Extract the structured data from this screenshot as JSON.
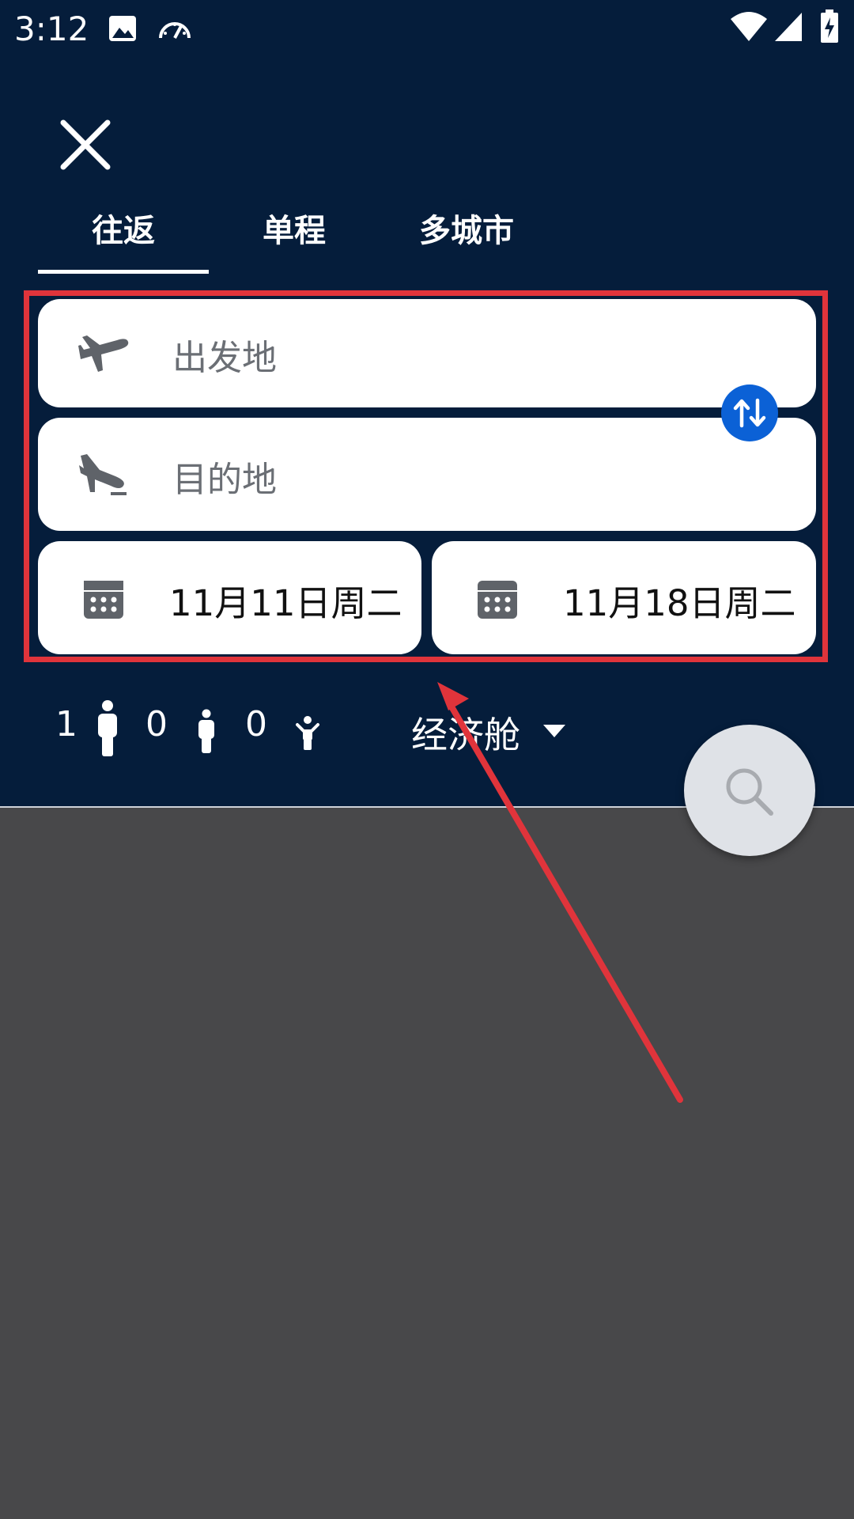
{
  "status_bar": {
    "time": "3:12"
  },
  "tabs": [
    {
      "label": "往返",
      "active": true
    },
    {
      "label": "单程",
      "active": false
    },
    {
      "label": "多城市",
      "active": false
    }
  ],
  "form": {
    "origin_placeholder": "出发地",
    "destination_placeholder": "目的地",
    "depart_date": "11月11日周二",
    "return_date": "11月18日周二"
  },
  "passengers": {
    "adults": "1",
    "children": "0",
    "infants": "0"
  },
  "cabin_class": "经济舱",
  "colors": {
    "header_bg": "#051d3b",
    "accent_blue": "#0b61d6",
    "annotation_red": "#e0343b",
    "overlay_gray": "#48484a"
  },
  "icons": {
    "close": "close-icon",
    "origin": "takeoff-plane-icon",
    "destination": "landing-plane-icon",
    "swap": "swap-vertical-icon",
    "calendar": "calendar-icon",
    "adult": "adult-person-icon",
    "child": "child-person-icon",
    "infant": "infant-person-icon",
    "dropdown": "dropdown-caret-icon",
    "search": "search-icon"
  }
}
